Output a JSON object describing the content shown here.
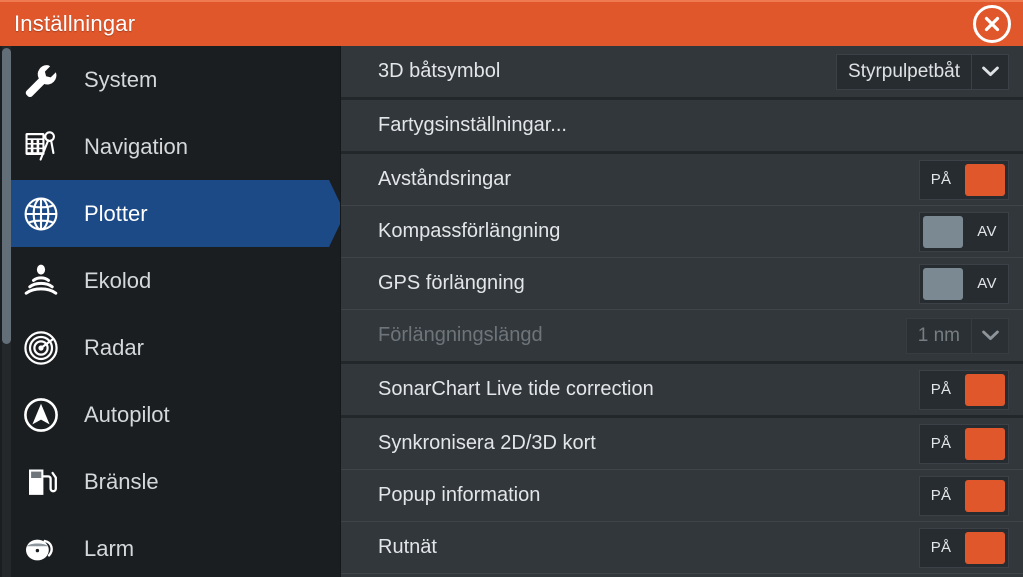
{
  "window": {
    "title": "Inställningar",
    "close_icon": "close-circle-icon",
    "accent_color": "#e0572c",
    "selection_color": "#1c4a87",
    "panel_bg": "#32373b",
    "sidebar_bg": "#1b1e20"
  },
  "sidebar": {
    "items": [
      {
        "label": "System",
        "icon": "wrench-icon",
        "selected": false
      },
      {
        "label": "Navigation",
        "icon": "chart-dividers-icon",
        "selected": false
      },
      {
        "label": "Plotter",
        "icon": "globe-icon",
        "selected": true
      },
      {
        "label": "Ekolod",
        "icon": "sonar-icon",
        "selected": false
      },
      {
        "label": "Radar",
        "icon": "radar-icon",
        "selected": false
      },
      {
        "label": "Autopilot",
        "icon": "autopilot-icon",
        "selected": false
      },
      {
        "label": "Bränsle",
        "icon": "fuel-pump-icon",
        "selected": false
      },
      {
        "label": "Larm",
        "icon": "alarm-bell-icon",
        "selected": false
      }
    ]
  },
  "settings": {
    "rows": [
      {
        "label": "3D båtsymbol",
        "control": "dropdown",
        "value": "Styrpulpetbåt",
        "enabled": true,
        "separator_after": "group"
      },
      {
        "label": "Fartygsinställningar...",
        "control": "none",
        "enabled": true,
        "separator_after": "group"
      },
      {
        "label": "Avståndsringar",
        "control": "toggle",
        "value": "PÅ",
        "state": "on",
        "enabled": true,
        "separator_after": "line"
      },
      {
        "label": "Kompassförlängning",
        "control": "toggle",
        "value": "AV",
        "state": "off",
        "enabled": true,
        "separator_after": "line"
      },
      {
        "label": "GPS förlängning",
        "control": "toggle",
        "value": "AV",
        "state": "off",
        "enabled": true,
        "separator_after": "line"
      },
      {
        "label": "Förlängningslängd",
        "control": "dropdown",
        "value": "1 nm",
        "enabled": false,
        "separator_after": "group"
      },
      {
        "label": "SonarChart Live tide correction",
        "control": "toggle",
        "value": "PÅ",
        "state": "on",
        "enabled": true,
        "separator_after": "group"
      },
      {
        "label": "Synkronisera 2D/3D kort",
        "control": "toggle",
        "value": "PÅ",
        "state": "on",
        "enabled": true,
        "separator_after": "line"
      },
      {
        "label": "Popup information",
        "control": "toggle",
        "value": "PÅ",
        "state": "on",
        "enabled": true,
        "separator_after": "line"
      },
      {
        "label": "Rutnät",
        "control": "toggle",
        "value": "PÅ",
        "state": "on",
        "enabled": true,
        "separator_after": "line"
      }
    ]
  },
  "scrollbar": {
    "name": "sidebar-scrollbar"
  }
}
